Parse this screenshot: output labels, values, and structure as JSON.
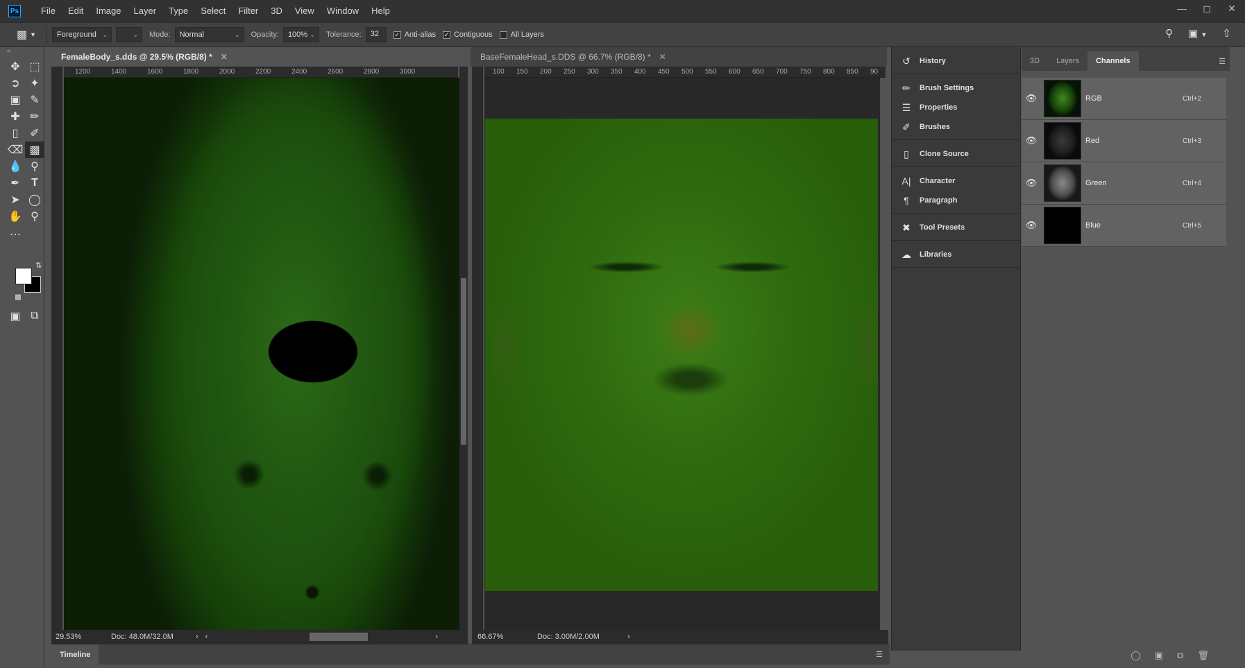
{
  "app": {
    "logo": "Ps"
  },
  "menu": [
    "File",
    "Edit",
    "Image",
    "Layer",
    "Type",
    "Select",
    "Filter",
    "3D",
    "View",
    "Window",
    "Help"
  ],
  "window_controls": {
    "minimize": "—",
    "maximize": "◻",
    "close": "✕"
  },
  "options": {
    "fill_source": "Foreground",
    "mode_label": "Mode:",
    "mode_value": "Normal",
    "opacity_label": "Opacity:",
    "opacity_value": "100%",
    "tolerance_label": "Tolerance:",
    "tolerance_value": "32",
    "antialias_label": "Anti-alias",
    "antialias_checked": true,
    "contiguous_label": "Contiguous",
    "contiguous_checked": true,
    "all_layers_label": "All Layers",
    "all_layers_checked": false
  },
  "tools": [
    "move-tool-icon",
    "marquee-tool-icon",
    "lasso-tool-icon",
    "magic-wand-tool-icon",
    "crop-tool-icon",
    "eyedropper-tool-icon",
    "healing-brush-icon",
    "brush-tool-icon",
    "clone-stamp-icon",
    "history-brush-icon",
    "eraser-tool-icon",
    "paint-bucket-icon",
    "blur-tool-icon",
    "dodge-tool-icon",
    "pen-tool-icon",
    "type-tool-icon",
    "path-selection-icon",
    "ellipse-tool-icon",
    "hand-tool-icon",
    "zoom-tool-icon"
  ],
  "doc1": {
    "tab_title": "FemaleBody_s.dds @ 29.5% (RGB/8) *",
    "ruler_ticks": [
      "1200",
      "1400",
      "1600",
      "1800",
      "2000",
      "2200",
      "2400",
      "2600",
      "2800",
      "3000"
    ],
    "zoom": "29.53%",
    "doc_size": "Doc: 48.0M/32.0M"
  },
  "doc2": {
    "tab_title": "BaseFemaleHead_s.DDS @ 66.7% (RGB/8) *",
    "ruler_ticks": [
      "100",
      "150",
      "200",
      "250",
      "300",
      "350",
      "400",
      "450",
      "500",
      "550",
      "600",
      "650",
      "700",
      "750",
      "800",
      "850",
      "90"
    ],
    "zoom": "66.67%",
    "doc_size": "Doc: 3.00M/2.00M"
  },
  "dock": [
    [
      "History"
    ],
    [
      "Brush Settings",
      "Properties",
      "Brushes"
    ],
    [
      "Clone Source"
    ],
    [
      "Character",
      "Paragraph"
    ],
    [
      "Tool Presets"
    ],
    [
      "Libraries"
    ]
  ],
  "panel": {
    "tabs": [
      "3D",
      "Layers",
      "Channels"
    ],
    "active_tab": "Channels",
    "channels": [
      {
        "name": "RGB",
        "shortcut": "Ctrl+2"
      },
      {
        "name": "Red",
        "shortcut": "Ctrl+3"
      },
      {
        "name": "Green",
        "shortcut": "Ctrl+4"
      },
      {
        "name": "Blue",
        "shortcut": "Ctrl+5"
      }
    ]
  },
  "timeline": {
    "label": "Timeline"
  },
  "colors": {
    "foreground": "#ffffff",
    "background": "#000000",
    "accent": "#31a8ff"
  }
}
